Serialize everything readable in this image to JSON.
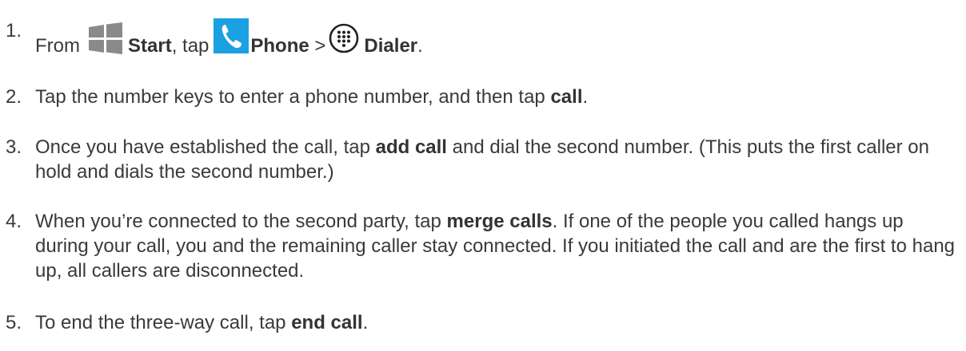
{
  "steps": [
    {
      "number": "1.",
      "parts": {
        "a": "From",
        "start_label": "Start",
        "b": ", tap",
        "phone_label": "Phone",
        "c": ">",
        "dialer_label": "Dialer",
        "d": "."
      },
      "icons": [
        "windows-start-icon",
        "phone-icon",
        "dialer-keypad-icon"
      ]
    },
    {
      "number": "2.",
      "text": "Tap the number keys to enter a phone number, and then tap",
      "bold": "call",
      "end": "."
    },
    {
      "number": "3.",
      "text": "Once you have established the call, tap",
      "bold": "add call",
      "end": "and dial the second number. (This puts the first caller on hold and dials the second number.)"
    },
    {
      "number": "4.",
      "text": "When you’re connected to the second party, tap",
      "bold": "merge calls",
      "end": ". If one of the people you called hangs up during your call, you and the remaining caller stay connected. If you initiated the call and are the first to hang up, all callers are disconnected."
    },
    {
      "number": "5.",
      "text": "To end the three-way call, tap",
      "bold": "end call",
      "end": "."
    }
  ],
  "colors": {
    "text": "#3a3a3a",
    "phone_tile": "#1ba1e2",
    "windows_logo": "#8a8a8a"
  }
}
